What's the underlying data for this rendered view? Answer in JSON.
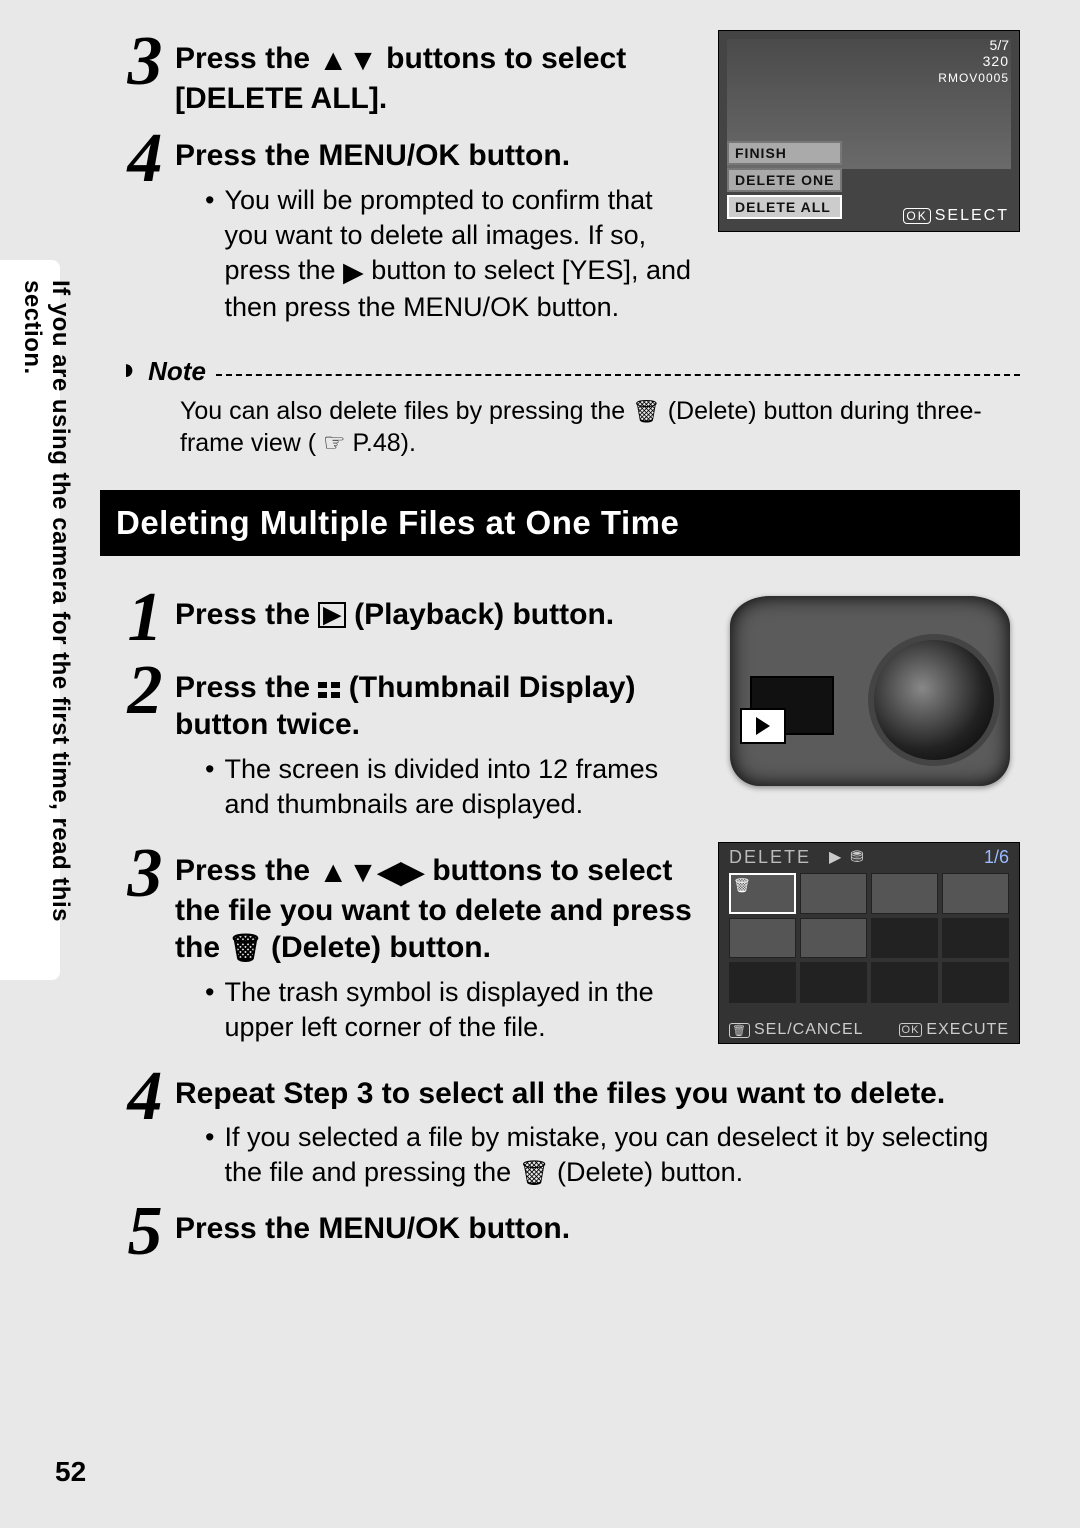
{
  "side_text": "If you are using the camera for the first time, read this section.",
  "top": {
    "step3_title_a": "Press the ",
    "step3_title_b": " buttons to select [DELETE ALL].",
    "step4_title": "Press the MENU/OK button.",
    "step4_bullet_a": "You will be prompted to confirm that you want to delete all images. If so, press the ",
    "step4_bullet_b": " button to select [YES], and then press the MENU/OK button."
  },
  "fig1": {
    "menu_finish": "FINISH",
    "menu_delete_one": "DELETE ONE",
    "menu_delete_all": "DELETE ALL",
    "select": "SELECT",
    "ok": "OK",
    "counter": "5/7",
    "size": "320",
    "fname": "RMOV0005"
  },
  "note": {
    "label": "Note",
    "body_a": "You can also delete files by pressing the ",
    "body_b": " (Delete) button during three-frame view (",
    "body_c": "P.48)."
  },
  "section_title": "Deleting Multiple Files at One Time",
  "multi": {
    "step1_a": "Press the ",
    "step1_b": " (Playback) button.",
    "step2_a": "Press the ",
    "step2_b": " (Thumbnail Display) button twice.",
    "step2_bullet": "The screen is divided into 12 frames and thumbnails are displayed.",
    "step3_a": "Press the ",
    "step3_b": " buttons to select the file you want to delete and press the ",
    "step3_c": " (Delete) button.",
    "step3_bullet": "The trash symbol is displayed in the upper left corner of the file.",
    "step4_title": "Repeat Step 3 to select all the files you want to delete.",
    "step4_bullet_a": "If you selected a file by mistake, you can deselect it by selecting the file and pressing the ",
    "step4_bullet_b": " (Delete) button.",
    "step5_title": "Press the MENU/OK button."
  },
  "fig_thumbs": {
    "title": "DELETE",
    "count": "1/6",
    "sel_cancel": "SEL/CANCEL",
    "execute": "EXECUTE",
    "trash_mark": "🗑",
    "ok": "OK"
  },
  "page_number": "52"
}
